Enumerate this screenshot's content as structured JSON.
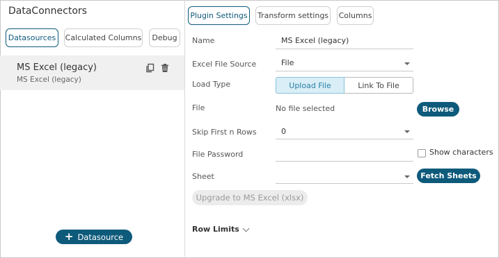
{
  "app": {
    "title": "DataConnectors"
  },
  "left_tabs": [
    {
      "label": "Datasources",
      "active": true
    },
    {
      "label": "Calculated Columns",
      "active": false
    },
    {
      "label": "Debug",
      "active": false
    }
  ],
  "datasource": {
    "name": "MS Excel (legacy)",
    "subtitle": "MS Excel (legacy)",
    "icons": [
      "copy-icon",
      "trash-icon"
    ]
  },
  "add_button": {
    "label": "Datasource",
    "icon": "plus-icon"
  },
  "right_tabs": [
    {
      "label": "Plugin Settings",
      "active": true
    },
    {
      "label": "Transform settings",
      "active": false
    },
    {
      "label": "Columns",
      "active": false
    }
  ],
  "form": {
    "name_label": "Name",
    "name_value": "MS Excel (legacy)",
    "source_label": "Excel File Source",
    "source_value": "File",
    "load_type_label": "Load Type",
    "load_options": [
      "Upload File",
      "Link To File"
    ],
    "load_selected": "Upload File",
    "file_label": "File",
    "file_value": "No file selected",
    "browse_label": "Browse",
    "skip_label": "Skip First n Rows",
    "skip_value": "0",
    "password_label": "File Password",
    "password_value": "",
    "show_characters_label": "Show characters",
    "sheet_label": "Sheet",
    "sheet_value": "",
    "fetch_label": "Fetch Sheets",
    "upgrade_label": "Upgrade to MS Excel (xlsx)",
    "row_limits_label": "Row Limits"
  },
  "colors": {
    "accent": "#0e5a7b",
    "toggle_bg": "#d9eef6",
    "toggle_text": "#2a7fa6"
  }
}
